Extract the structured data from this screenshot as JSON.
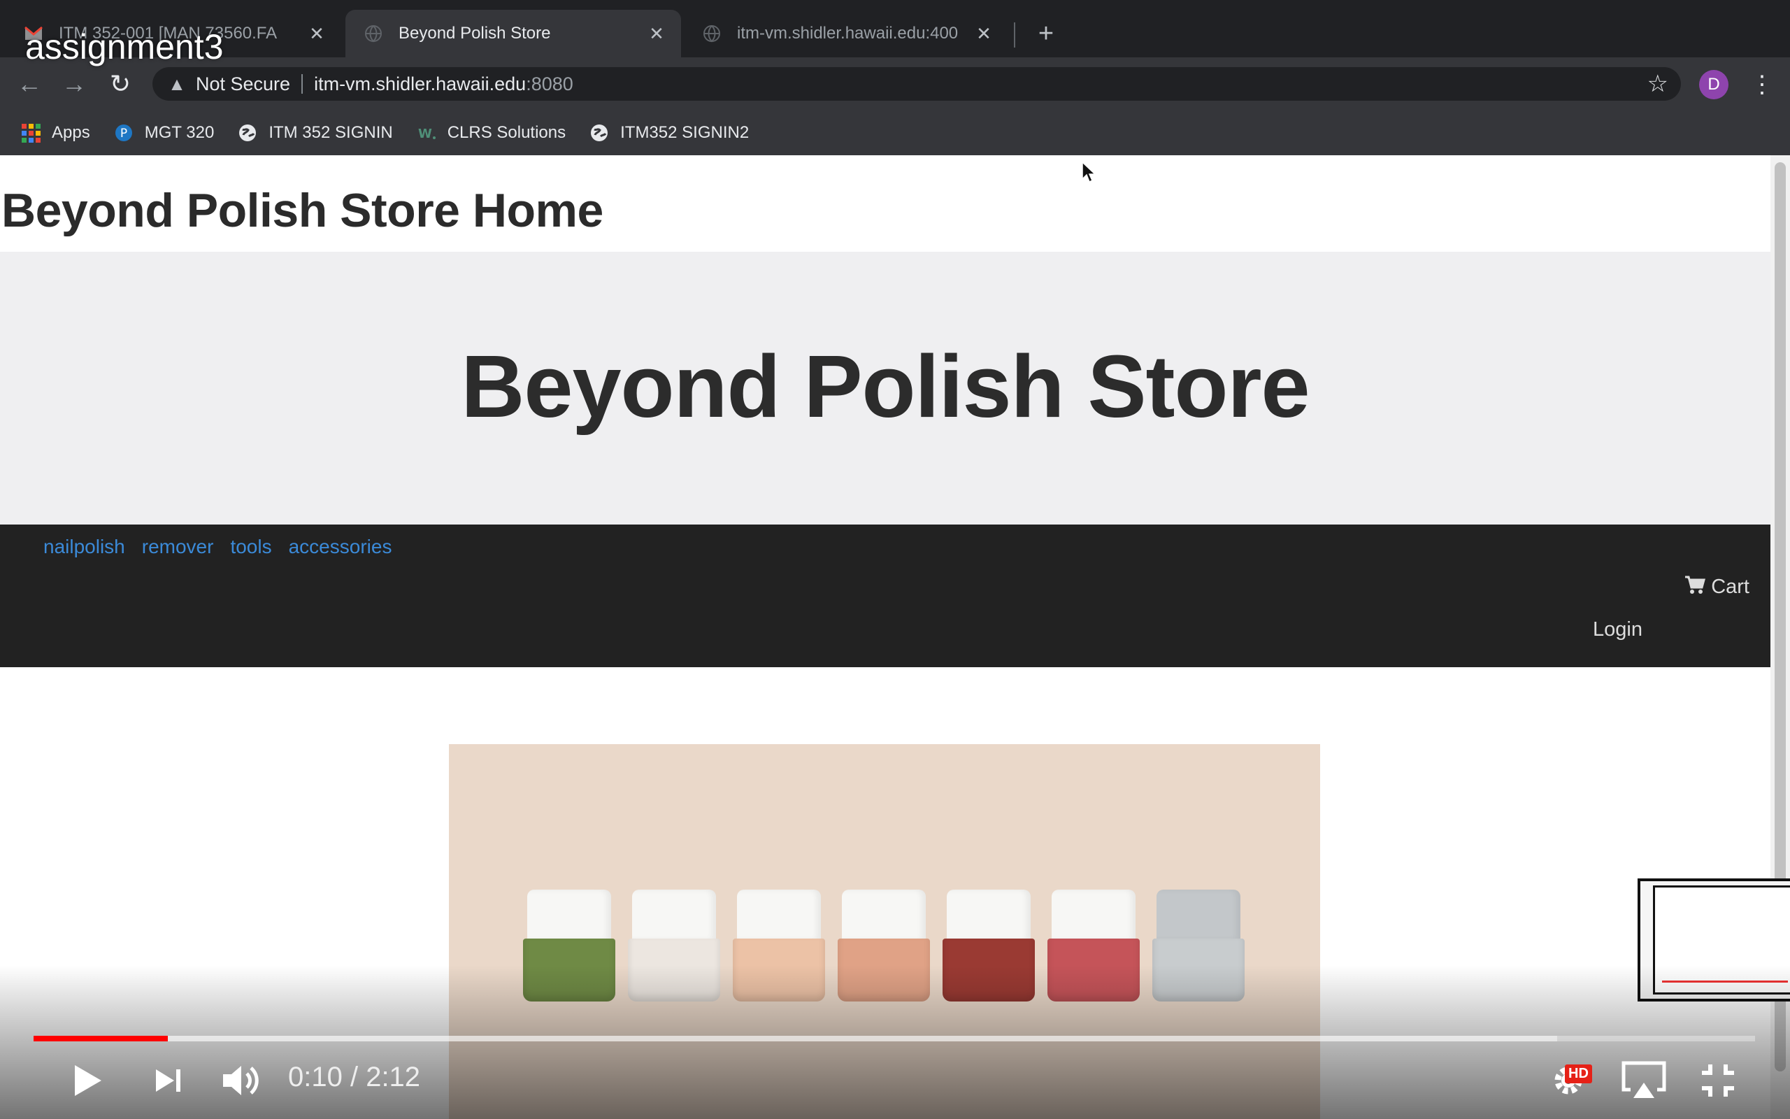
{
  "video": {
    "title": "assignment3",
    "current_time": "0:10",
    "duration": "2:12",
    "time_display": "0:10 / 2:12",
    "progress_fraction": 0.078,
    "quality_badge": "HD"
  },
  "browser": {
    "tabs": [
      {
        "title": "ITM 352-001 [MAN 73560.FA",
        "active": false
      },
      {
        "title": "Beyond Polish Store",
        "active": true
      },
      {
        "title": "itm-vm.shidler.hawaii.edu:400",
        "active": false
      }
    ],
    "address": {
      "security_label": "Not Secure",
      "host": "itm-vm.shidler.hawaii.edu",
      "port": ":8080"
    },
    "profile_initial": "D",
    "bookmarks": [
      {
        "label": "Apps",
        "icon": "apps-grid-icon"
      },
      {
        "label": "MGT 320",
        "icon": "pearson-icon"
      },
      {
        "label": "ITM 352 SIGNIN",
        "icon": "globe-icon"
      },
      {
        "label": "CLRS Solutions",
        "icon": "wordpress-icon"
      },
      {
        "label": "ITM352 SIGNIN2",
        "icon": "globe-icon"
      }
    ]
  },
  "page": {
    "heading": "Beyond Polish Store Home",
    "hero_title": "Beyond Polish Store",
    "nav_links": [
      "nailpolish",
      "remover",
      "tools",
      "accessories"
    ],
    "cart_label": "Cart",
    "login_label": "Login",
    "bottle_colors": [
      "#6f8a45",
      "#ece6e0",
      "#ecc2a6",
      "#e0a286",
      "#9a3a33",
      "#c55459",
      "#c8ccce"
    ]
  },
  "colors": {
    "accent_red": "#ff0000",
    "link_blue": "#3b8ad8",
    "nav_bg": "#222222",
    "hero_bg": "#efeff1"
  }
}
